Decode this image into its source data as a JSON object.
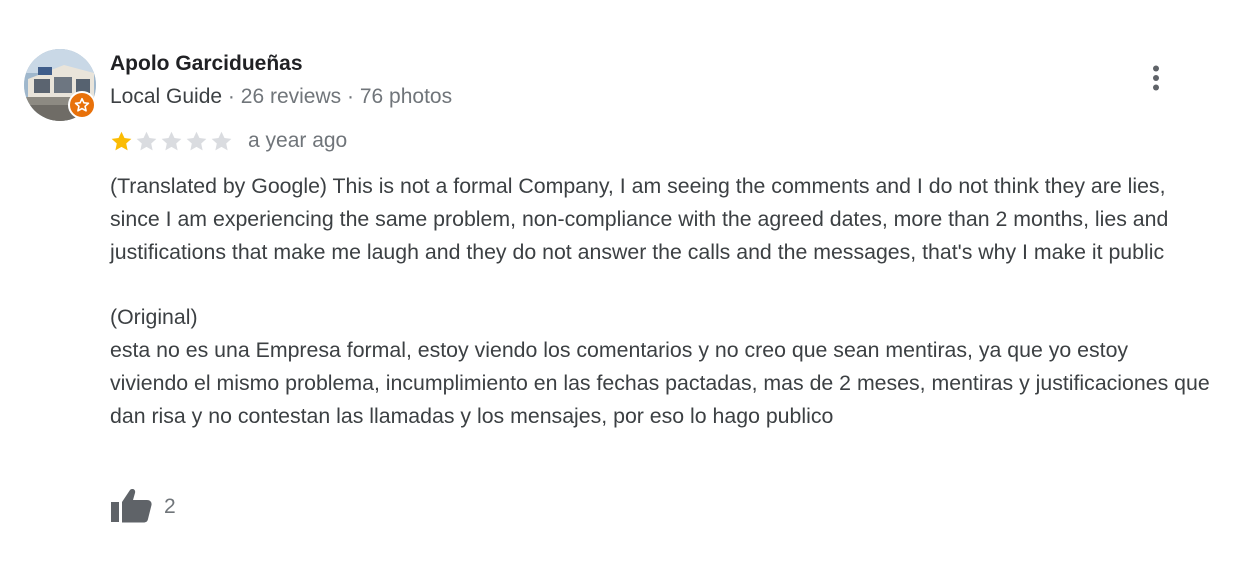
{
  "review": {
    "author": {
      "name": "Apolo Garcidueñas",
      "badge": "Local Guide",
      "separator": "·",
      "reviews": "26 reviews",
      "photos": "76 photos"
    },
    "rating": {
      "value": 1,
      "max": 5,
      "filled_color": "#fbbc04",
      "empty_color": "#dadce0"
    },
    "time_ago": "a year ago",
    "translated_text": "(Translated by Google) This is not a formal Company, I am seeing the comments and I do not think they are lies, since I am experiencing the same problem, non-compliance with the agreed dates, more than 2 months, lies and justifications that make me laugh and they do not answer the calls and the messages, that's why I make it public",
    "original_label": "(Original)",
    "original_text": "esta no es una Empresa formal, estoy viendo los comentarios y no creo que sean mentiras, ya que yo estoy viviendo el mismo problema, incumplimiento en las fechas pactadas, mas de 2 meses, mentiras y justificaciones que dan risa y no contestan las llamadas y los mensajes, por eso lo hago publico",
    "likes": "2"
  },
  "icons": {
    "menu": "more-vert-icon",
    "like": "thumbs-up-icon",
    "star": "star-icon",
    "guide_badge": "local-guide-star-icon"
  },
  "colors": {
    "guide_badge": "#e8710a",
    "name": "#202124",
    "meta": "#70757a",
    "body": "#3c4043"
  }
}
